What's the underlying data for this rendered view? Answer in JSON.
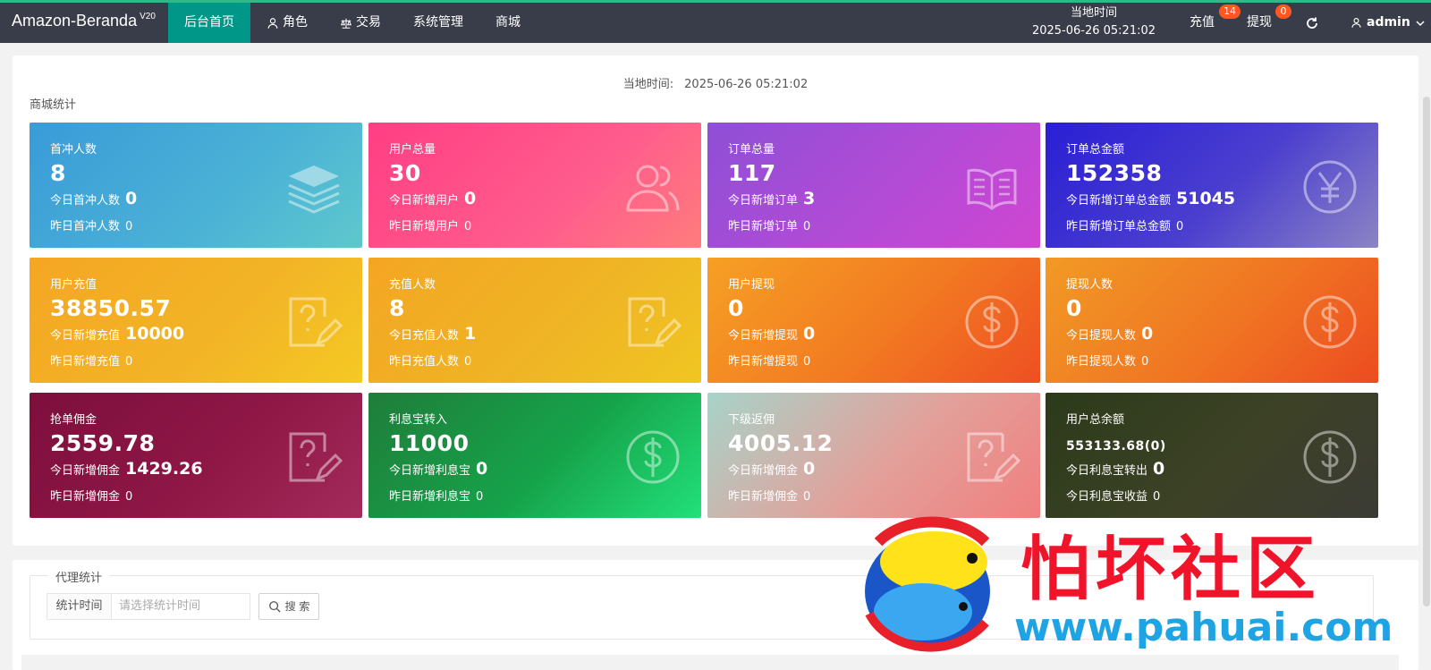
{
  "header": {
    "brand": "Amazon-Beranda",
    "version": "V20",
    "nav": [
      {
        "label": "后台首页",
        "active": true,
        "icon": ""
      },
      {
        "label": "角色",
        "active": false,
        "icon": "user-icon"
      },
      {
        "label": "交易",
        "active": false,
        "icon": "scale-icon"
      },
      {
        "label": "系统管理",
        "active": false,
        "icon": ""
      },
      {
        "label": "商城",
        "active": false,
        "icon": ""
      }
    ],
    "time_label": "当地时间",
    "time_value": "2025-06-26 05:21:02",
    "recharge": {
      "label": "充值",
      "badge": "14"
    },
    "withdraw": {
      "label": "提现",
      "badge": "0"
    },
    "refresh_icon": "refresh-icon",
    "user": {
      "icon": "user-icon",
      "name": "admin",
      "chevron": "chevron-down-icon"
    }
  },
  "main": {
    "local_time_label": "当地时间:",
    "local_time_value": "2025-06-26 05:21:02",
    "section_title": "商城统计",
    "cards": [
      {
        "title": "首冲人数",
        "value": "8",
        "today_label": "今日首冲人数",
        "today_value": "0",
        "yest_label": "昨日首冲人数",
        "yest_value": "0",
        "icon": "layers-icon"
      },
      {
        "title": "用户总量",
        "value": "30",
        "today_label": "今日新增用户",
        "today_value": "0",
        "yest_label": "昨日新增用户",
        "yest_value": "0",
        "icon": "users-icon"
      },
      {
        "title": "订单总量",
        "value": "117",
        "today_label": "今日新增订单",
        "today_value": "3",
        "yest_label": "昨日新增订单",
        "yest_value": "0",
        "icon": "book-icon"
      },
      {
        "title": "订单总金额",
        "value": "152358",
        "today_label": "今日新增订单总金额",
        "today_value": "51045",
        "yest_label": "昨日新增订单总金额",
        "yest_value": "0",
        "icon": "yen-icon"
      },
      {
        "title": "用户充值",
        "value": "38850.57",
        "today_label": "今日新增充值",
        "today_value": "10000",
        "yest_label": "昨日新增充值",
        "yest_value": "0",
        "icon": "question-edit-icon"
      },
      {
        "title": "充值人数",
        "value": "8",
        "today_label": "今日充值人数",
        "today_value": "1",
        "yest_label": "昨日充值人数",
        "yest_value": "0",
        "icon": "question-edit-icon"
      },
      {
        "title": "用户提现",
        "value": "0",
        "today_label": "今日新增提现",
        "today_value": "0",
        "yest_label": "昨日新增提现",
        "yest_value": "0",
        "icon": "dollar-icon"
      },
      {
        "title": "提现人数",
        "value": "0",
        "today_label": "今日提现人数",
        "today_value": "0",
        "yest_label": "昨日提现人数",
        "yest_value": "0",
        "icon": "dollar-icon"
      },
      {
        "title": "抢单佣金",
        "value": "2559.78",
        "today_label": "今日新增佣金",
        "today_value": "1429.26",
        "yest_label": "昨日新增佣金",
        "yest_value": "0",
        "icon": "question-edit-icon"
      },
      {
        "title": "利息宝转入",
        "value": "11000",
        "today_label": "今日新增利息宝",
        "today_value": "0",
        "yest_label": "昨日新增利息宝",
        "yest_value": "0",
        "icon": "dollar-icon"
      },
      {
        "title": "下级返佣",
        "value": "4005.12",
        "today_label": "今日新增佣金",
        "today_value": "0",
        "yest_label": "昨日新增佣金",
        "yest_value": "0",
        "icon": "question-edit-icon"
      },
      {
        "title": "用户总余额",
        "value": "553133.68(0)",
        "today_label": "今日利息宝转出",
        "today_value": "0",
        "yest_label": "今日利息宝收益",
        "yest_value": "0",
        "icon": "dollar-icon"
      }
    ]
  },
  "agent": {
    "legend": "代理统计",
    "filter_label": "统计时间",
    "filter_placeholder": "请选择统计时间",
    "search_label": "搜 索"
  },
  "watermark": {
    "text": "怕坏社区",
    "url": "www.pahuai.com"
  }
}
